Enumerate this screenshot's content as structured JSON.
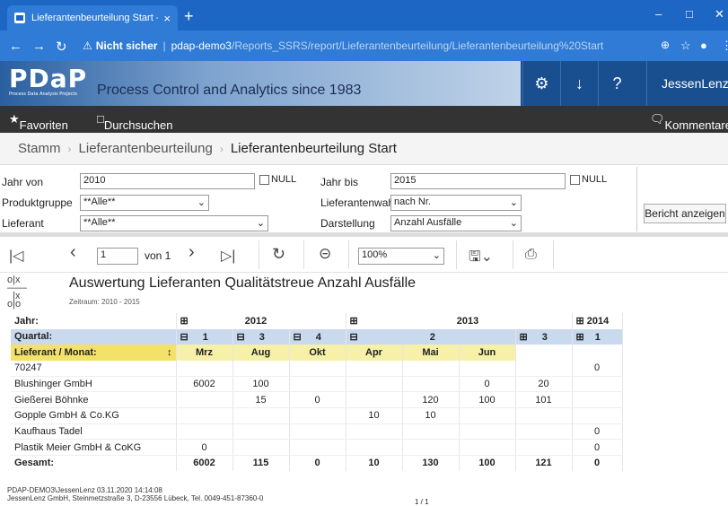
{
  "browser": {
    "tab_title": "Lieferantenbeurteilung Start - SC",
    "tab_close": "×",
    "new_tab": "+",
    "url_security": "Nicht sicher",
    "url_host": "pdap-demo3",
    "url_path": "/Reports_SSRS/report/Lieferantenbeurteilung/Lieferantenbeurteilung%20Start"
  },
  "header": {
    "logo_text": "PDaP",
    "logo_sub": "Process Data Analysis Projects",
    "slogan": "Process Control and Analytics since 1983",
    "user": "JessenLenz"
  },
  "toolbar": {
    "favorites": "Favoriten",
    "browse": "Durchsuchen",
    "comments": "Kommentare"
  },
  "breadcrumb": {
    "items": [
      "Stamm",
      "Lieferantenbeurteilung",
      "Lieferantenbeurteilung Start"
    ]
  },
  "params": {
    "jahr_von_label": "Jahr von",
    "jahr_von_value": "2010",
    "null_label": "NULL",
    "jahr_bis_label": "Jahr bis",
    "jahr_bis_value": "2015",
    "produktgruppe_label": "Produktgruppe",
    "produktgruppe_value": "**Alle**",
    "lieferantenwahl_label": "Lieferantenwahl",
    "lieferantenwahl_value": "nach Nr.",
    "lieferant_label": "Lieferant",
    "lieferant_value": "**Alle**",
    "darstellung_label": "Darstellung",
    "darstellung_value": "Anzahl Ausfälle",
    "run_button": "Bericht anzeigen"
  },
  "report_toolbar": {
    "page_value": "1",
    "page_of": "von 1",
    "zoom": "100%"
  },
  "report": {
    "title": "Auswertung Lieferanten Qualitätstreue Anzahl Ausfälle",
    "subtitle": "Zeitraum: 2010 - 2015",
    "year_row_label": "Jahr:",
    "quarter_row_label": "Quartal:",
    "month_row_label": "Lieferant / Monat:",
    "years": [
      "2012",
      "2013",
      "2014"
    ],
    "quarters": [
      "1",
      "3",
      "4",
      "2",
      "3",
      "1"
    ],
    "months": [
      "Mrz",
      "Aug",
      "Okt",
      "Apr",
      "Mai",
      "Jun",
      "",
      ""
    ],
    "rows": [
      {
        "name": "70247",
        "values": [
          "",
          "",
          "",
          "",
          "",
          "",
          "",
          "0"
        ]
      },
      {
        "name": "Blushinger GmbH",
        "values": [
          "6002",
          "100",
          "",
          "",
          "",
          "0",
          "20",
          ""
        ]
      },
      {
        "name": "Gießerei Böhnke",
        "values": [
          "",
          "15",
          "0",
          "",
          "120",
          "100",
          "101",
          ""
        ]
      },
      {
        "name": "Gopple GmbH & Co.KG",
        "values": [
          "",
          "",
          "",
          "10",
          "10",
          "",
          "",
          ""
        ]
      },
      {
        "name": "Kaufhaus Tadel",
        "values": [
          "",
          "",
          "",
          "",
          "",
          "",
          "",
          "0"
        ]
      },
      {
        "name": "Plastik Meier GmbH & CoKG",
        "values": [
          "0",
          "",
          "",
          "",
          "",
          "",
          "",
          "0"
        ]
      }
    ],
    "total_label": "Gesamt:",
    "totals": [
      "6002",
      "115",
      "0",
      "10",
      "130",
      "100",
      "121",
      "0"
    ]
  },
  "footer": {
    "line1": "PDAP-DEMO3\\JessenLenz 03.11.2020 14:14:08",
    "line2": "JessenLenz GmbH, Steinmetzstraße 3, D-23556 Lübeck, Tel. 0049-451-87360-0",
    "page": "1 / 1"
  }
}
